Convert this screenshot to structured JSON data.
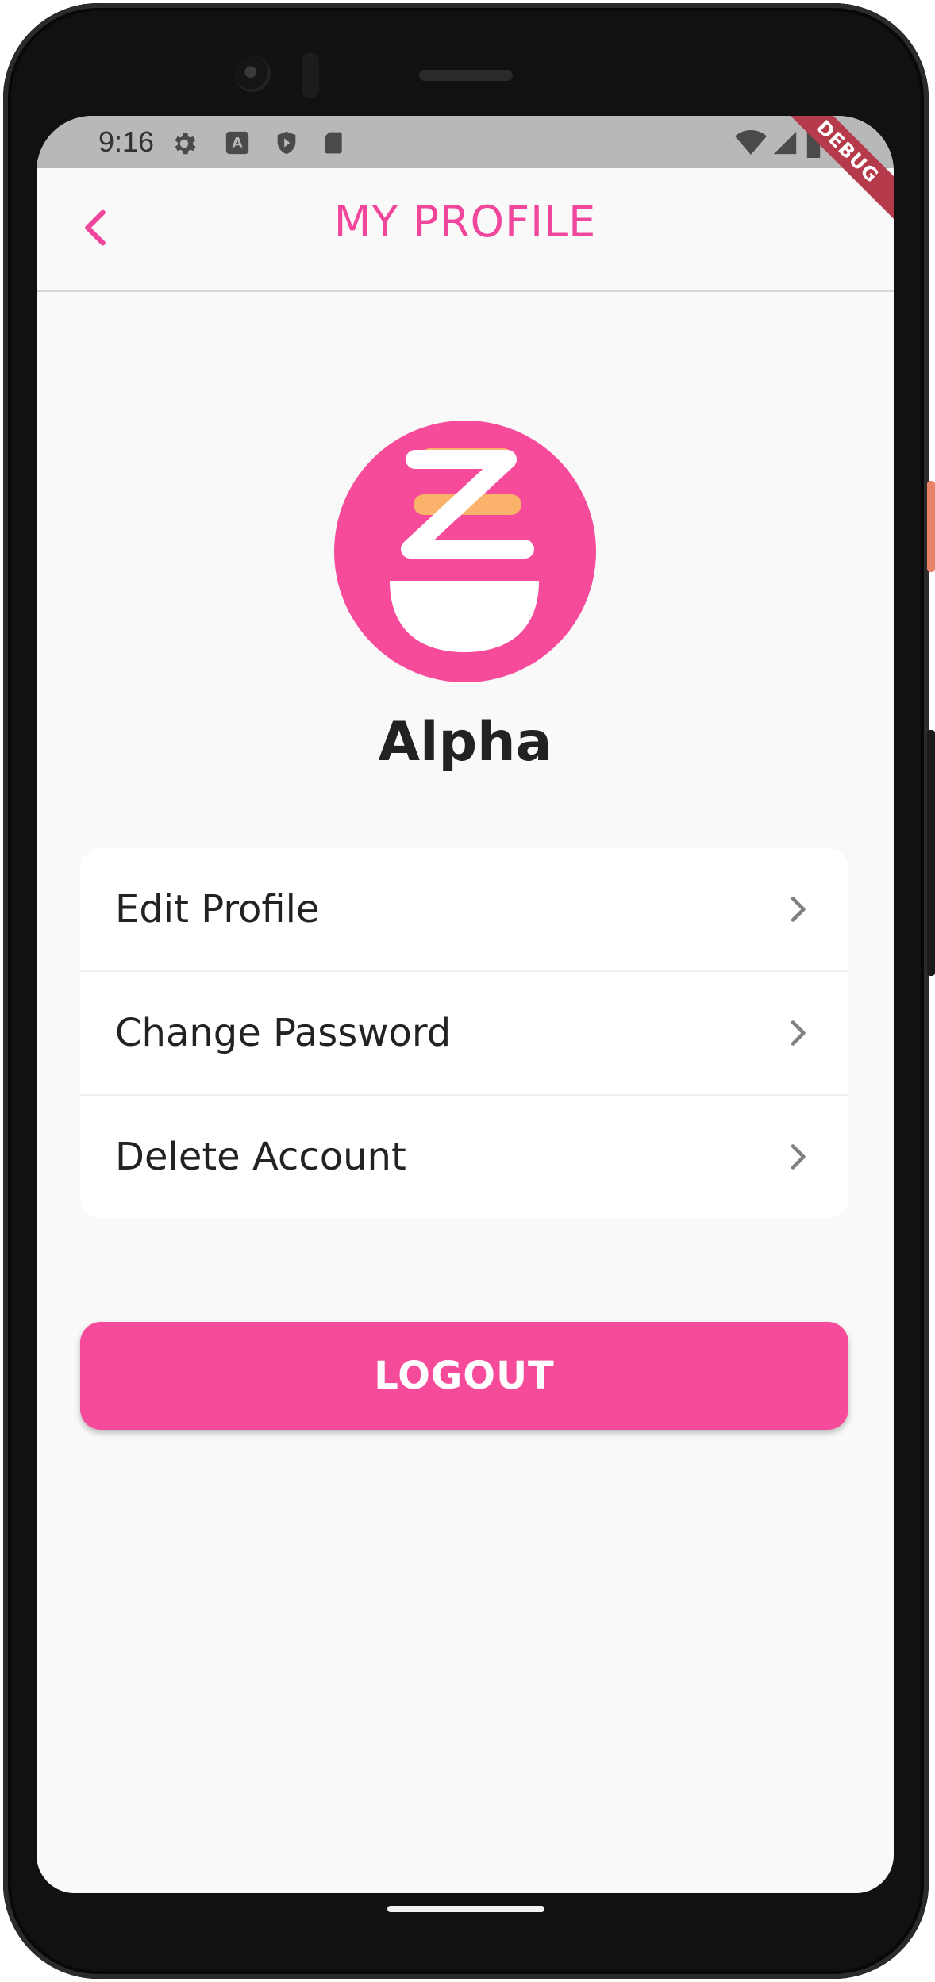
{
  "status_bar": {
    "time": "9:16",
    "left_icons": [
      "settings-icon",
      "keyboard-a-icon",
      "shield-icon",
      "sd-card-icon"
    ],
    "right_icons": [
      "wifi-icon",
      "cell-signal-icon",
      "battery-icon"
    ]
  },
  "debug_banner": "DEBUG",
  "app_bar": {
    "title": "MY PROFILE",
    "back_icon": "chevron-left-icon"
  },
  "profile": {
    "logo": "brand-bowl-logo",
    "name": "Alpha"
  },
  "menu": {
    "items": [
      {
        "label": "Edit Profile",
        "icon": "chevron-right-icon"
      },
      {
        "label": "Change Password",
        "icon": "chevron-right-icon"
      },
      {
        "label": "Delete Account",
        "icon": "chevron-right-icon"
      }
    ]
  },
  "logout_label": "LOGOUT",
  "colors": {
    "accent": "#f64b9b",
    "title": "#f0469c",
    "logo_stripe": "#fbb26b",
    "background": "#f9f9f9",
    "debug_banner": "#b53a4a"
  }
}
